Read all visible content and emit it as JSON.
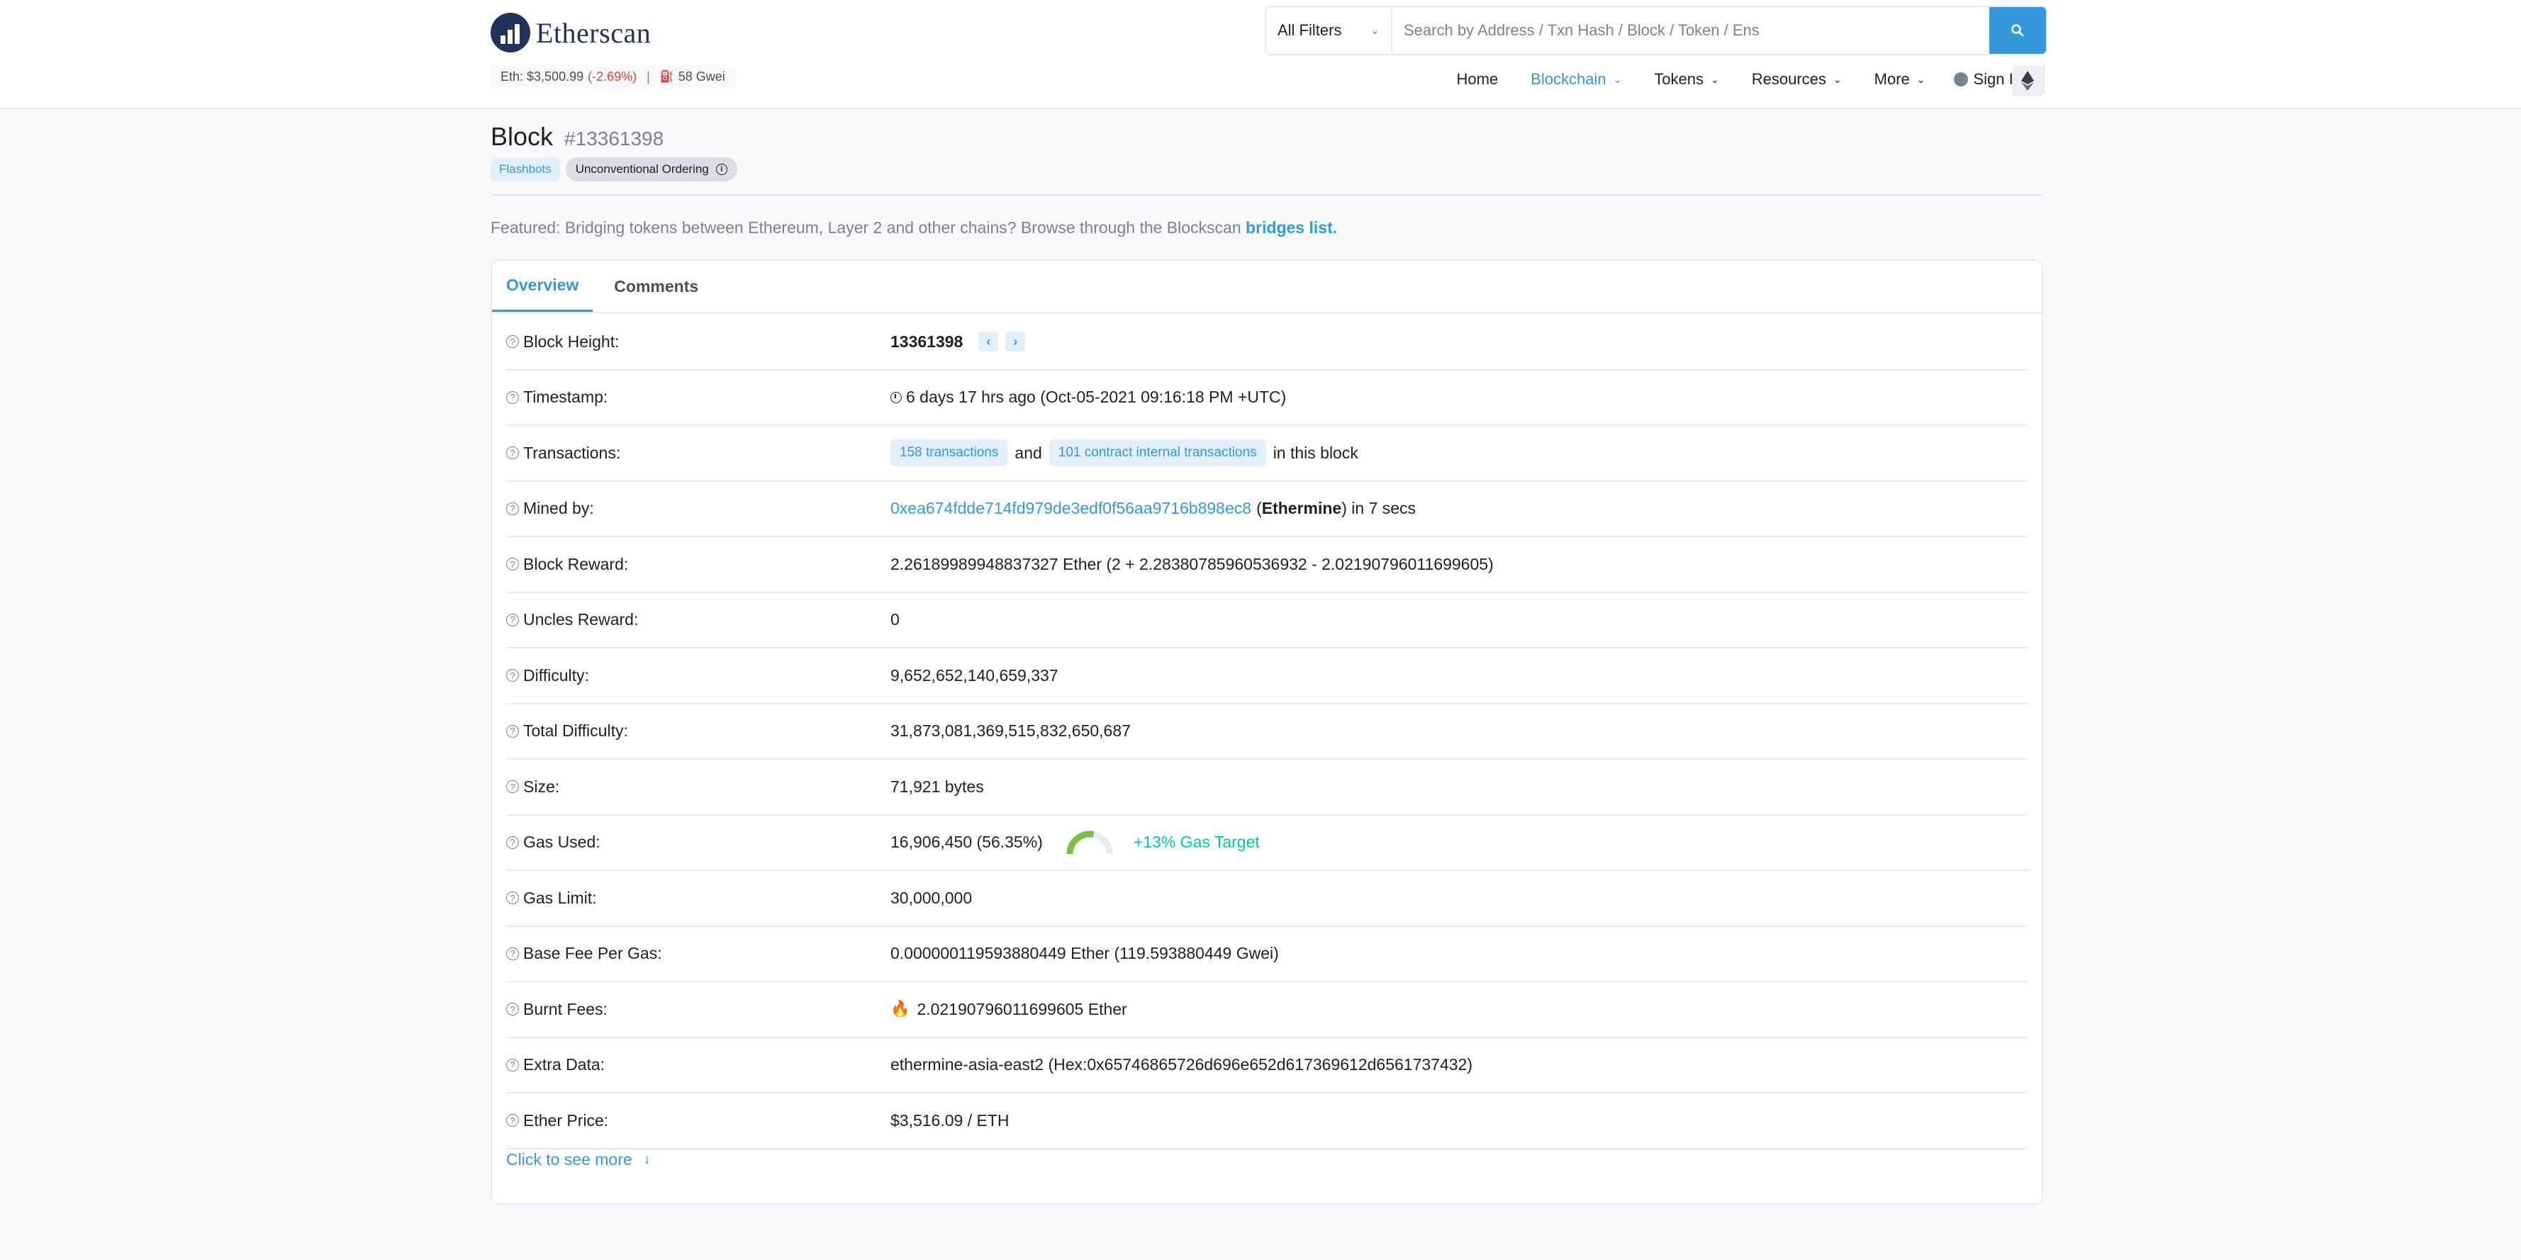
{
  "header": {
    "brand": "Etherscan",
    "price_label": "Eth: $3,500.99",
    "price_change": "(-2.69%)",
    "separator": "|",
    "gas": "58 Gwei",
    "filter": "All Filters",
    "search_placeholder": "Search by Address / Txn Hash / Block / Token / Ens",
    "nav": {
      "home": "Home",
      "blockchain": "Blockchain",
      "tokens": "Tokens",
      "resources": "Resources",
      "more": "More",
      "sign_in": "Sign In"
    }
  },
  "page": {
    "title": "Block",
    "block_number": "#13361398",
    "badge_flashbots": "Flashbots",
    "badge_unconventional": "Unconventional Ordering",
    "featured_text": "Featured: Bridging tokens between Ethereum, Layer 2 and other chains? Browse through the Blockscan ",
    "featured_link": "bridges list."
  },
  "tabs": {
    "overview": "Overview",
    "comments": "Comments"
  },
  "rows": {
    "block_height": {
      "label": "Block Height:",
      "value": "13361398"
    },
    "timestamp": {
      "label": "Timestamp:",
      "value": "6 days 17 hrs ago (Oct-05-2021 09:16:18 PM +UTC)"
    },
    "transactions": {
      "label": "Transactions:",
      "tx_badge": "158 transactions",
      "and": "and",
      "internal_badge": "101 contract internal transactions",
      "suffix": "in this block"
    },
    "mined_by": {
      "label": "Mined by:",
      "address": "0xea674fdde714fd979de3edf0f56aa9716b898ec8",
      "open_paren": "(",
      "miner": "Ethermine",
      "close": ") in 7 secs"
    },
    "block_reward": {
      "label": "Block Reward:",
      "value": "2.26189989948837327 Ether (2 + 2.28380785960536932 - 2.02190796011699605)"
    },
    "uncles_reward": {
      "label": "Uncles Reward:",
      "value": "0"
    },
    "difficulty": {
      "label": "Difficulty:",
      "value": "9,652,652,140,659,337"
    },
    "total_difficulty": {
      "label": "Total Difficulty:",
      "value": "31,873,081,369,515,832,650,687"
    },
    "size": {
      "label": "Size:",
      "value": "71,921 bytes"
    },
    "gas_used": {
      "label": "Gas Used:",
      "value": "16,906,450 (56.35%)",
      "gauge_fraction": 0.5635,
      "target": "+13% Gas Target"
    },
    "gas_limit": {
      "label": "Gas Limit:",
      "value": "30,000,000"
    },
    "base_fee": {
      "label": "Base Fee Per Gas:",
      "value": "0.000000119593880449 Ether (119.593880449 Gwei)"
    },
    "burnt_fees": {
      "label": "Burnt Fees:",
      "value": "2.02190796011699605 Ether"
    },
    "extra_data": {
      "label": "Extra Data:",
      "value": "ethermine-asia-east2 (Hex:0x65746865726d696e652d617369612d6561737432)"
    },
    "ether_price": {
      "label": "Ether Price:",
      "value": "$3,516.09 / ETH"
    }
  },
  "see_more": "Click to see more",
  "colors": {
    "accent": "#3498db",
    "negative": "#de4437",
    "success": "#00c9a7",
    "gauge": "#7ac142"
  }
}
